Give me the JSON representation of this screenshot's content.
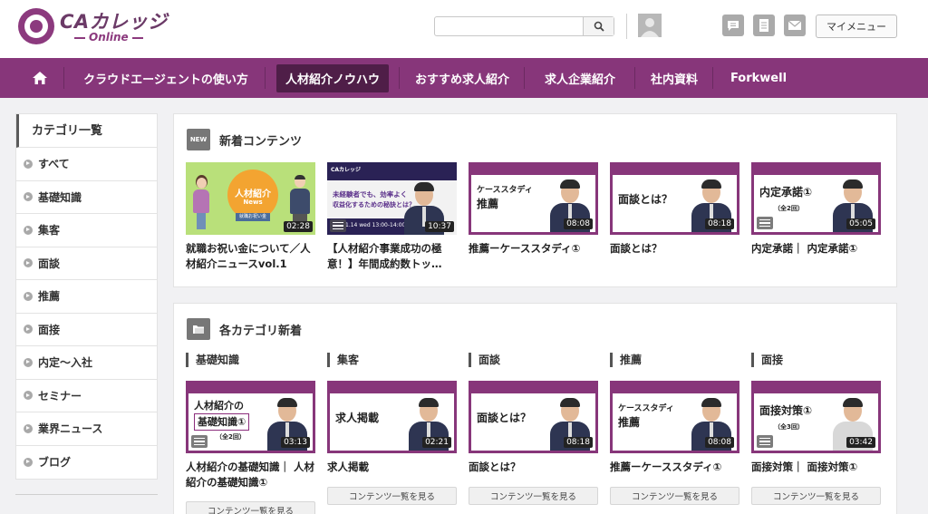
{
  "header": {
    "logo_main": "CAカレッジ",
    "logo_sub": "Online",
    "search_placeholder": "",
    "my_menu_label": "マイメニュー",
    "icons": [
      "search-icon",
      "user-avatar-icon",
      "message-icon",
      "document-icon",
      "mail-icon"
    ]
  },
  "nav": {
    "items": [
      {
        "label": "クラウドエージェントの使い方"
      },
      {
        "label": "人材紹介ノウハウ"
      },
      {
        "label": "おすすめ求人紹介"
      },
      {
        "label": "求人企業紹介"
      },
      {
        "label": "社内資料"
      },
      {
        "label": "Forkwell"
      }
    ],
    "active_index": 1,
    "home_icon": "home-icon"
  },
  "sidebar": {
    "title": "カテゴリ一覧",
    "items": [
      {
        "label": "すべて"
      },
      {
        "label": "基礎知識"
      },
      {
        "label": "集客"
      },
      {
        "label": "面談"
      },
      {
        "label": "推薦"
      },
      {
        "label": "面接"
      },
      {
        "label": "内定〜入社"
      },
      {
        "label": "セミナー"
      },
      {
        "label": "業界ニュース"
      },
      {
        "label": "ブログ"
      }
    ]
  },
  "new_contents": {
    "badge": "NEW",
    "title": "新着コンテンツ",
    "cards": [
      {
        "title": "就職お祝い金について／人材紹介ニュースvol.1",
        "duration": "02:28",
        "thumb_text": "人材紹介",
        "thumb_sub": "News",
        "thumb_small": "就職お祝い金"
      },
      {
        "title": "【人材紹介事業成功の極意！】年間成約数トッ…",
        "duration": "10:37",
        "thumb_text": "未経験者でも、効率よく",
        "thumb_sub": "収益化するための秘訣とは？",
        "thumb_small": "1.14 wed 13:00-14:00"
      },
      {
        "title": "推薦ーケーススタディ①",
        "duration": "08:08",
        "thumb_top": "動画で学ぶ人材紹介",
        "thumb_text": "ケーススタディ",
        "thumb_sub": "推薦"
      },
      {
        "title": "面談とは？",
        "duration": "08:18",
        "thumb_top": "動画で学ぶ人材紹介",
        "thumb_text": "面談とは？"
      },
      {
        "title": "内定承諾｜ 内定承諾①",
        "duration": "05:05",
        "thumb_top": "動画で学ぶ人材紹介",
        "thumb_text": "内定承諾①",
        "thumb_sub": "（全2回）"
      }
    ]
  },
  "category_new": {
    "title": "各カテゴリ新着",
    "more_label": "コンテンツ一覧を見る",
    "categories": [
      {
        "label": "基礎知識",
        "card_title": "人材紹介の基礎知識｜ 人材紹介の基礎知識①",
        "duration": "03:13",
        "thumb_top": "動画で学ぶ人材紹介",
        "thumb_text": "人材紹介の",
        "thumb_text2": "基礎知識①",
        "thumb_sub": "（全2回）"
      },
      {
        "label": "集客",
        "card_title": "求人掲載",
        "duration": "02:21",
        "thumb_top": "動画で学ぶ人材紹介",
        "thumb_text": "求人掲載"
      },
      {
        "label": "面談",
        "card_title": "面談とは？",
        "duration": "08:18",
        "thumb_top": "動画で学ぶ人材紹介",
        "thumb_text": "面談とは？"
      },
      {
        "label": "推薦",
        "card_title": "推薦ーケーススタディ①",
        "duration": "08:08",
        "thumb_top": "動画で学ぶ人材紹介",
        "thumb_text": "ケーススタディ",
        "thumb_sub": "推薦"
      },
      {
        "label": "面接",
        "card_title": "面接対策｜ 面接対策①",
        "duration": "03:42",
        "thumb_top": "動画で学ぶ人材紹介",
        "thumb_text": "面接対策①",
        "thumb_sub": "（全3回）"
      }
    ]
  },
  "colors": {
    "brand_purple": "#87367a",
    "nav_active": "#4f1e48"
  }
}
